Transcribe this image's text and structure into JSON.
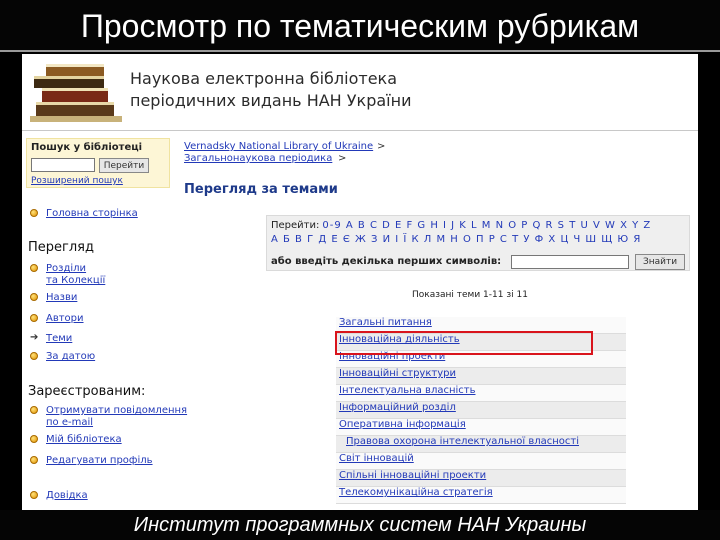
{
  "slide": {
    "title": "Просмотр по тематическим рубрикам",
    "footer": "Институт программных систем НАН Украины"
  },
  "header": {
    "line1": "Наукова електронна бібліотека",
    "line2": "періодичних видань НАН України"
  },
  "search": {
    "label": "Пошук у бібліотеці",
    "button": "Перейти",
    "advanced": "Розширений пошук"
  },
  "nav": {
    "home": "Головна сторінка",
    "browse_heading": "Перегляд",
    "communities_line1": "Розділи",
    "communities_line2": "та Колекції",
    "titles": "Назви",
    "authors": "Автори",
    "subjects": "Теми",
    "by_date": "За датою",
    "registered_heading": "Зареєстрованим:",
    "subscribe_line1": "Отримувати повідомлення",
    "subscribe_line2": "по e-mail",
    "my_library": "Мій бібліотека",
    "edit_profile": "Редагувати профіль",
    "help": "Довідка"
  },
  "breadcrumb": {
    "item1": "Vernadsky National Library of Ukraine",
    "item2": "Загальнонаукова періодика",
    "sep": ">"
  },
  "page_heading": "Перегляд за темами",
  "alphabet": {
    "goto_label": "Перейти:",
    "latin": "0-9 A B C D E F G H I J K L M N O P Q R S T U V W X Y Z",
    "cyrillic": "А Б В Г Д Е Є Ж З И І Ї К Л М Н О П Р С Т У Ф Х Ц Ч Ш Щ Ю Я",
    "input_label": "або введіть декілька перших символів:",
    "button": "Знайти"
  },
  "shown_text": "Показані теми 1-11 зі 11",
  "topics": [
    "Загальні питання",
    "Інноваційна діяльність",
    "Інноваційні проекти",
    "Інноваційні структури",
    "Інтелектуальна власність",
    "Інформаційний розділ",
    "Оперативна інформація",
    "Правова охорона інтелектуальної власності",
    "Світ інновацій",
    "Спільні інноваційні проекти",
    "Телекомунікаційна стратегія"
  ],
  "colors": {
    "link": "#2239b8",
    "highlight": "#d9141c",
    "search_bg": "#fdf6d6",
    "heading": "#1e3a8a"
  }
}
